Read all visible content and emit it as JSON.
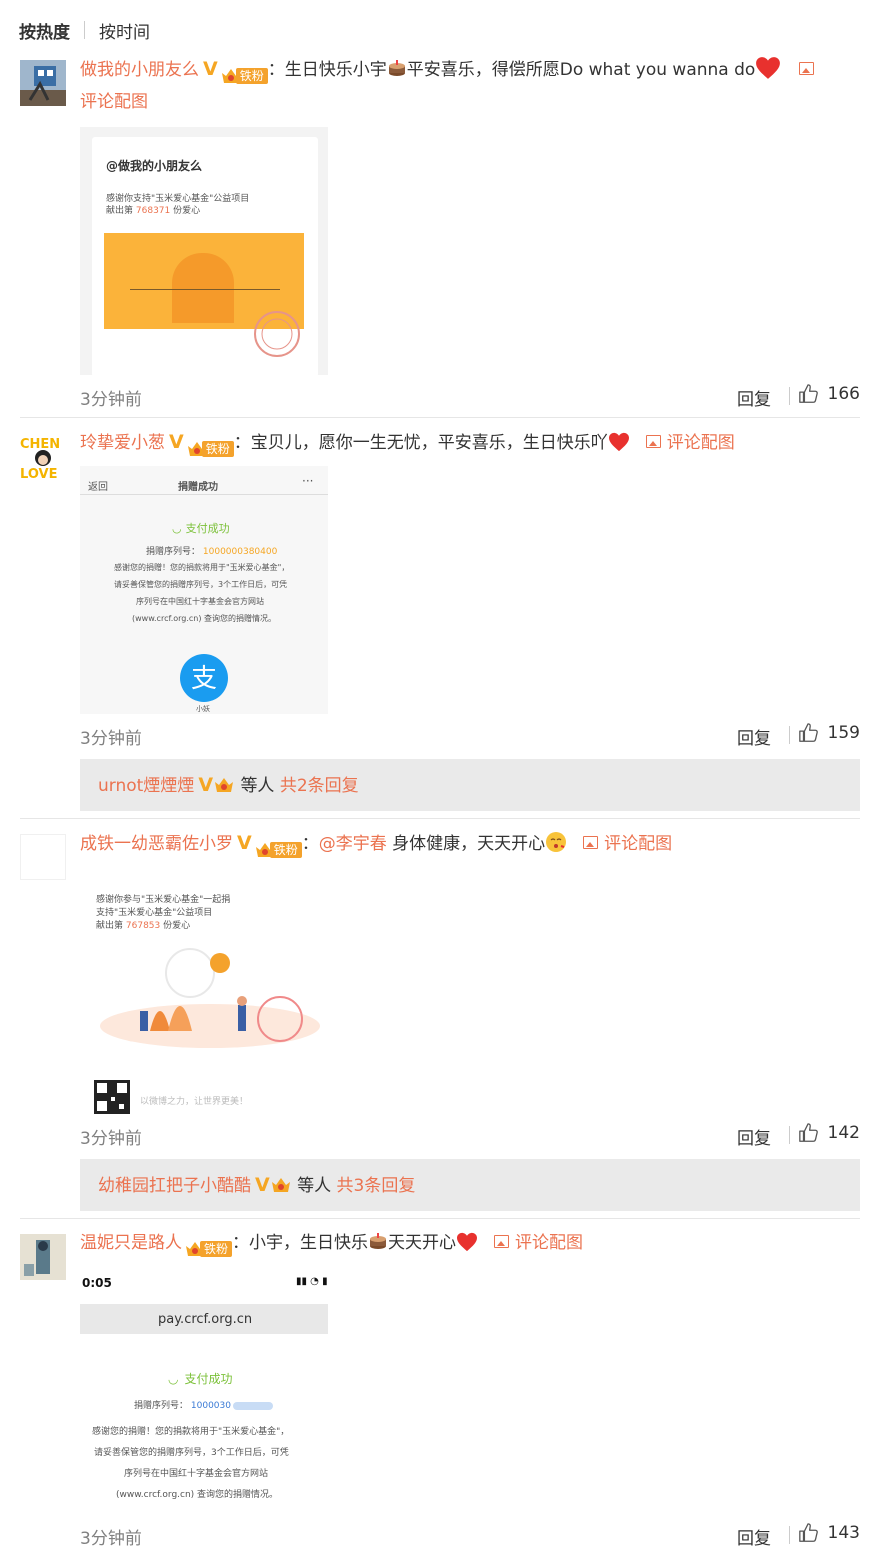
{
  "tabs": {
    "hot": "按热度",
    "time": "按时间"
  },
  "common": {
    "reply_label": "回复",
    "pic_label": "评论配图",
    "fan_tag": "铁粉"
  },
  "comments": [
    {
      "username": "做我的小朋友么",
      "text": "生日快乐小宇",
      "text2": "平安喜乐，得偿所愿Do what you wanna do",
      "time": "3分钟前",
      "likes": "166",
      "image": {
        "title": "@做我的小朋友么",
        "line1": "感谢你支持\"玉米爱心基金\"公益项目",
        "line2": "献出第",
        "number": "768371",
        "line3": "份爱心"
      }
    },
    {
      "username": "玲挚爱小葱",
      "text": "宝贝儿，愿你一生无忧，平安喜乐，生日快乐吖",
      "time": "3分钟前",
      "likes": "159",
      "image": {
        "back": "返回",
        "header": "捐赠成功",
        "success": "支付成功",
        "serial_label": "捐赠序列号：",
        "serial": "1000000380400",
        "p1": "感谢您的捐赠！您的捐款将用于\"玉米爱心基金\"，",
        "p2": "请妥善保管您的捐赠序列号，3个工作日后，可凭",
        "p3": "序列号在中国红十字基金会官方网站",
        "p4": "(www.crcf.org.cn) 查询您的捐赠情况。",
        "app": "小妖"
      },
      "replies": {
        "user": "urnot煙煙煙",
        "suffix": "等人",
        "count": "共2条回复"
      }
    },
    {
      "username": "成铁一幼恶霸佐小罗",
      "mention": "@李宇春",
      "text": "身体健康，天天开心",
      "time": "3分钟前",
      "likes": "142",
      "image": {
        "line1": "感谢你参与\"玉米爱心基金\"一起捐",
        "line2": "支持\"玉米爱心基金\"公益项目",
        "line3": "献出第",
        "number": "767853",
        "line4": "份爱心",
        "foot": "以微博之力，让世界更美！"
      },
      "replies": {
        "user": "幼稚园扛把子小酷酷",
        "suffix": "等人",
        "count": "共3条回复"
      }
    },
    {
      "username": "温妮只是路人",
      "text": "小宇，生日快乐",
      "text2": "天天开心",
      "time": "3分钟前",
      "likes": "143",
      "image": {
        "clock": "0:05",
        "url": "pay.crcf.org.cn",
        "success": "支付成功",
        "serial_label": "捐赠序列号：",
        "serial": "1000030",
        "p1": "感谢您的捐赠！您的捐款将用于\"玉米爱心基金\"，",
        "p2": "请妥善保管您的捐赠序列号，3个工作日后，可凭",
        "p3": "序列号在中国红十字基金会官方网站",
        "p4": "(www.crcf.org.cn) 查询您的捐赠情况。"
      }
    }
  ],
  "colors": {
    "accent": "#eb7350",
    "badge": "#f5a623",
    "reply_bg": "#eaeaea"
  }
}
